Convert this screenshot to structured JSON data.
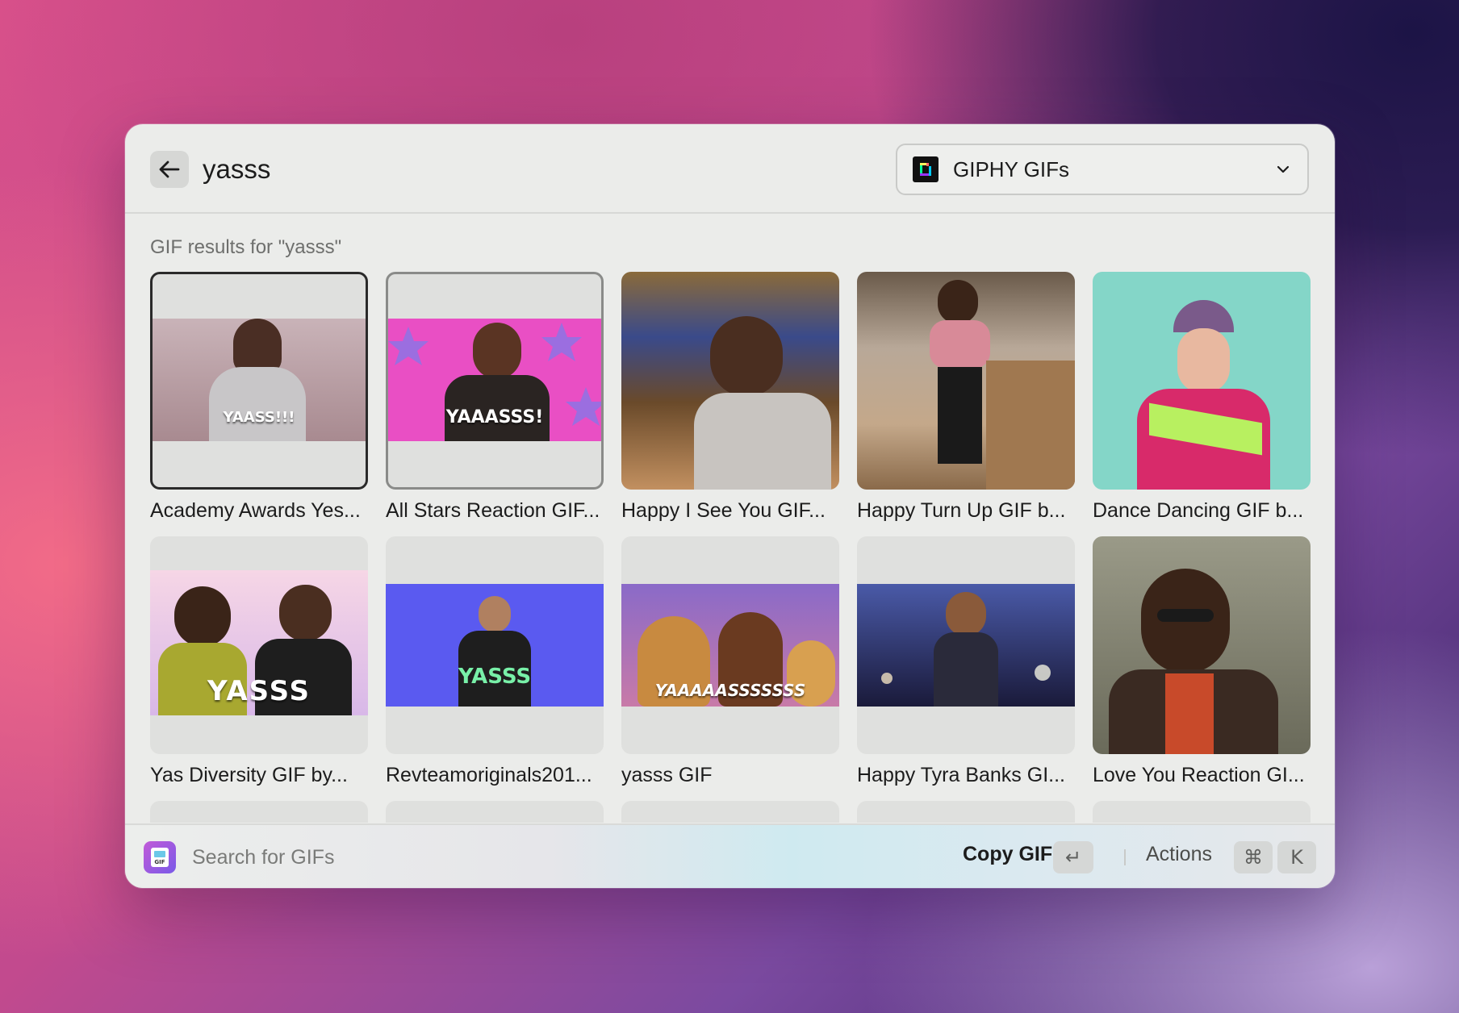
{
  "search": {
    "query": "yasss"
  },
  "source": {
    "label": "GIPHY GIFs"
  },
  "section_title": "GIF results for \"yasss\"",
  "results": [
    {
      "caption": "Academy Awards Yes...",
      "overlay": "YAASS!!!"
    },
    {
      "caption": "All Stars Reaction GIF...",
      "overlay": "YAAASSS!"
    },
    {
      "caption": "Happy I See You GIF...",
      "overlay": ""
    },
    {
      "caption": "Happy Turn Up GIF b...",
      "overlay": ""
    },
    {
      "caption": "Dance Dancing GIF b...",
      "overlay": ""
    },
    {
      "caption": "Yas Diversity GIF by...",
      "overlay": "YASSS"
    },
    {
      "caption": "Revteamoriginals201...",
      "overlay": "YASSS"
    },
    {
      "caption": "yasss GIF",
      "overlay": "YAAAAASSSSSSS"
    },
    {
      "caption": "Happy Tyra Banks GI...",
      "overlay": ""
    },
    {
      "caption": "Love You Reaction GI...",
      "overlay": ""
    }
  ],
  "footer": {
    "search_placeholder": "Search for GIFs",
    "primary_action": "Copy GIF",
    "enter_key": "↵",
    "actions_label": "Actions",
    "cmd_key": "⌘",
    "k_key": "K"
  }
}
